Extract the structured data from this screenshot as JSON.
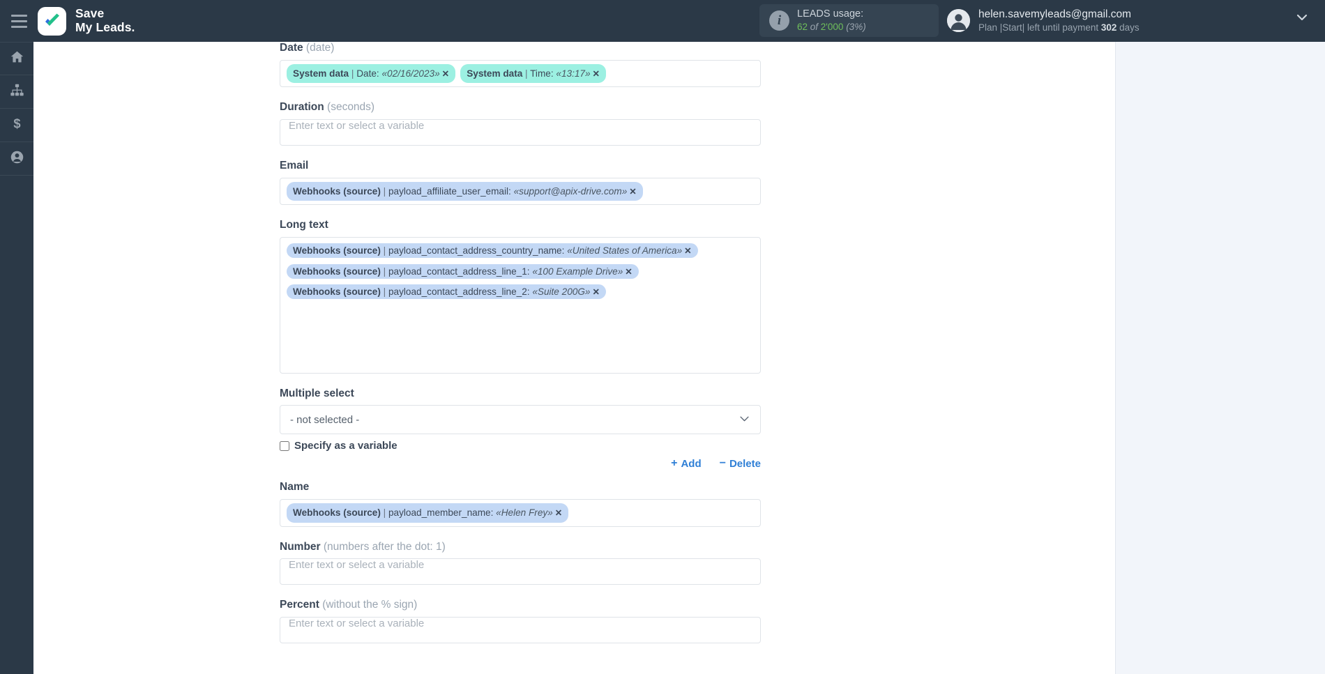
{
  "app": {
    "brand_line1": "Save",
    "brand_line2": "My Leads.",
    "menu_icon": "hamburger-icon"
  },
  "header": {
    "usage_title": "LEADS usage:",
    "usage_count": "62",
    "usage_of": " of ",
    "usage_total": "2'000",
    "usage_percent": "(3%)",
    "account_email": "helen.savemyleads@gmail.com",
    "plan_prefix": "Plan |Start| left until payment ",
    "plan_days": "302",
    "plan_suffix": " days"
  },
  "sidebar": {
    "items": [
      {
        "name": "home",
        "icon": "home-icon"
      },
      {
        "name": "connections",
        "icon": "sitemap-icon"
      },
      {
        "name": "billing",
        "icon": "dollar-icon"
      },
      {
        "name": "profile",
        "icon": "user-circle-icon"
      }
    ]
  },
  "form": {
    "placeholder": "Enter text or select a variable",
    "fields": [
      {
        "label": "Date",
        "hint": "(date)",
        "type": "chips",
        "chips": [
          {
            "color": "green",
            "source": "System data",
            "key": "Date:",
            "value": "«02/16/2023»"
          },
          {
            "color": "green",
            "source": "System data",
            "key": "Time:",
            "value": "«13:17»"
          }
        ]
      },
      {
        "label": "Duration",
        "hint": "(seconds)",
        "type": "empty"
      },
      {
        "label": "Email",
        "hint": "",
        "type": "chips",
        "chips": [
          {
            "color": "blue",
            "source": "Webhooks (source)",
            "key": "payload_affiliate_user_email:",
            "value": "«support@apix-drive.com»"
          }
        ]
      },
      {
        "label": "Long text",
        "hint": "",
        "type": "longtext",
        "chips": [
          {
            "color": "blue",
            "source": "Webhooks (source)",
            "key": "payload_contact_address_country_name:",
            "value": "«United States of America»"
          },
          {
            "color": "blue",
            "source": "Webhooks (source)",
            "key": "payload_contact_address_line_1:",
            "value": "«100 Example Drive»"
          },
          {
            "color": "blue",
            "source": "Webhooks (source)",
            "key": "payload_contact_address_line_2:",
            "value": "«Suite 200G»"
          }
        ]
      },
      {
        "label": "Multiple select",
        "hint": "",
        "type": "select",
        "selected": "- not selected -",
        "checkbox_label": "Specify as a variable",
        "add_label": "Add",
        "delete_label": "Delete",
        "add_symbol": "+",
        "delete_symbol": "−"
      },
      {
        "label": "Name",
        "hint": "",
        "type": "chips",
        "chips": [
          {
            "color": "blue",
            "source": "Webhooks (source)",
            "key": "payload_member_name:",
            "value": "«Helen Frey»"
          }
        ]
      },
      {
        "label": "Number",
        "hint": "(numbers after the dot: 1)",
        "type": "empty"
      },
      {
        "label": "Percent",
        "hint": "(without the % sign)",
        "type": "empty"
      }
    ]
  }
}
